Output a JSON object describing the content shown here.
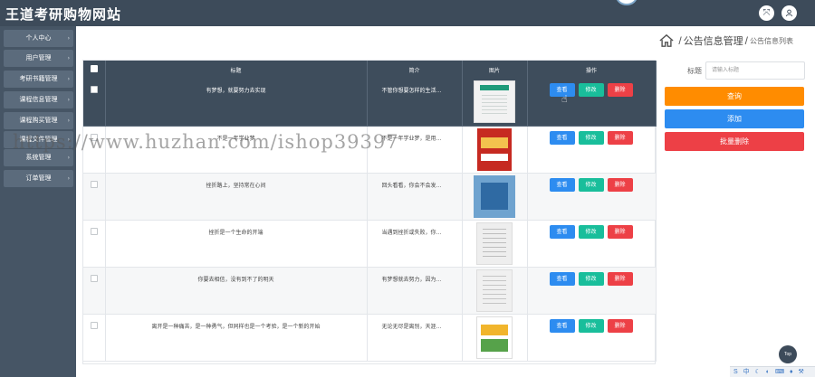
{
  "header": {
    "title": "王道考研购物网站",
    "settings_icon": "expand-icon",
    "user_icon": "user-icon"
  },
  "sidebar": {
    "items": [
      {
        "label": "个人中心"
      },
      {
        "label": "用户管理"
      },
      {
        "label": "考研书籍管理"
      },
      {
        "label": "课程信息管理"
      },
      {
        "label": "课程购买管理"
      },
      {
        "label": "课程文件管理"
      },
      {
        "label": "系统管理"
      },
      {
        "label": "订单管理"
      }
    ]
  },
  "breadcrumb": {
    "main": "公告信息管理",
    "separator": "/",
    "sub": "公告信息列表"
  },
  "table": {
    "columns": [
      "",
      "标题",
      "简介",
      "图片",
      "操作"
    ],
    "ops": {
      "view": "查看",
      "edit": "修改",
      "delete": "删除"
    },
    "rows": [
      {
        "title": "有梦想，就要努力去实现",
        "intro": "不管你想要怎样的生活..."
      },
      {
        "title": "不是一年学业梦",
        "intro": "不是一年学业梦，是用..."
      },
      {
        "title": "挫折路上，坚持常在心间",
        "intro": "回头看看，你会不会发..."
      },
      {
        "title": "挫折是一个生命的开端",
        "intro": "当遇到挫折或失败，你..."
      },
      {
        "title": "你要去相信，没有到不了的明天",
        "intro": "有梦想就去努力，因为..."
      },
      {
        "title": "离开是一种痛苦，是一种勇气，但同样也是一个考验，是一个新的开始",
        "intro": "无论无尽是离别，天涯..."
      }
    ]
  },
  "search": {
    "label": "标题",
    "placeholder": "请输入标题"
  },
  "buttons": {
    "query": "查询",
    "add": "添加",
    "batch_delete": "批量删除"
  },
  "top_button": "Top",
  "watermark": "https://www.huzhan.com/ishop39397",
  "tray": "S 中 ☾ ◐ ⌨ ♦ ⚒",
  "colors": {
    "header_bg": "#3d4b5a",
    "sidebar_bg": "#465565",
    "view": "#2d8cf0",
    "edit": "#19be9b",
    "delete": "#ed4046",
    "query": "#ff8c00"
  }
}
